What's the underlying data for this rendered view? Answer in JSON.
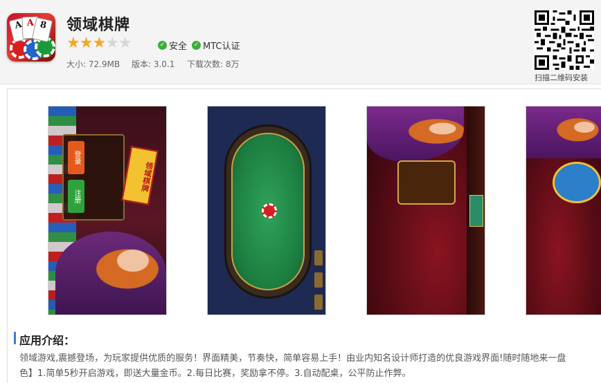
{
  "app": {
    "title": "领域棋牌",
    "rating_stars": 3,
    "rating_max": 5,
    "badges": [
      "安全",
      "MTC认证"
    ],
    "meta": {
      "size": "大小: 72.9MB",
      "version": "版本: 3.0.1",
      "downloads": "下载次数: 8万"
    },
    "icon_cards": [
      "A",
      "A",
      "8"
    ]
  },
  "qr": {
    "label": "扫描二维码安装"
  },
  "screenshots": {
    "count": 4,
    "shot1_buttons": [
      "登录",
      "注册"
    ],
    "shot1_logo": "领域棋牌"
  },
  "intro": {
    "title": "应用介绍：",
    "line1": "领域游戏,震撼登场，为玩家提供优质的服务！界面精美，节奏快，简单容易上手！由业内知名设计师打造的优良游戏界面!随时随地来一盘",
    "line2": "色】1.简单5秒开启游戏，即送大量金币。2.每日比赛，奖励拿不停。3.自动配桌，公平防止作弊。"
  },
  "colors": {
    "star_on": "#f5a623",
    "star_off": "#d6d6d6",
    "badge_green": "#3cae3c",
    "section_accent": "#3a7dd6"
  }
}
